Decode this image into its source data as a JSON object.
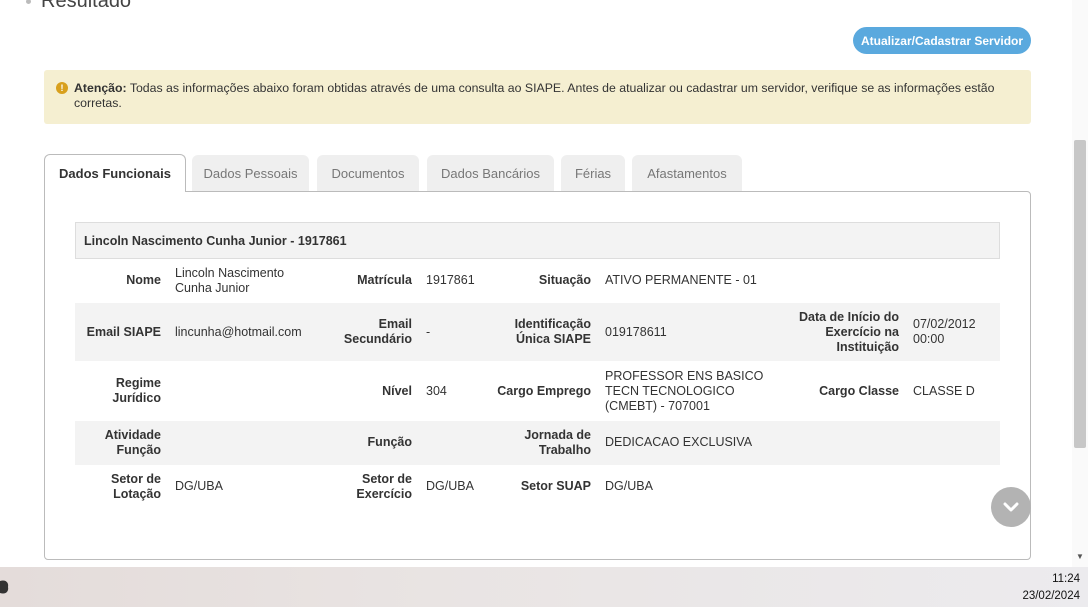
{
  "section": {
    "title": "Resultado"
  },
  "actions": {
    "update_button": "Atualizar/Cadastrar Servidor"
  },
  "alert": {
    "prefix": "Atenção:",
    "text": " Todas as informações abaixo foram obtidas através de uma consulta ao SIAPE. Antes de atualizar ou cadastrar um servidor, verifique se as informações estão corretas."
  },
  "tabs": [
    {
      "label": "Dados Funcionais",
      "active": true
    },
    {
      "label": "Dados Pessoais"
    },
    {
      "label": "Documentos"
    },
    {
      "label": "Dados Bancários"
    },
    {
      "label": "Férias"
    },
    {
      "label": "Afastamentos"
    }
  ],
  "record": {
    "header": "Lincoln Nascimento Cunha Junior - 1917861",
    "rows": [
      [
        {
          "label": "Nome",
          "value": "Lincoln Nascimento Cunha Junior"
        },
        {
          "label": "Matrícula",
          "value": "1917861"
        },
        {
          "label": "Situação",
          "value": "ATIVO PERMANENTE - 01"
        }
      ],
      [
        {
          "label": "Email SIAPE",
          "value": "lincunha@hotmail.com"
        },
        {
          "label": "Email Secundário",
          "value": "-"
        },
        {
          "label": "Identificação Única SIAPE",
          "value": "019178611"
        },
        {
          "label": "Data de Início do Exercício na Instituição",
          "value": "07/02/2012 00:00"
        }
      ],
      [
        {
          "label": "Regime Jurídico",
          "value": ""
        },
        {
          "label": "Nível",
          "value": "304"
        },
        {
          "label": "Cargo Emprego",
          "value": "PROFESSOR ENS BASICO TECN TECNOLOGICO (CMEBT) - 707001"
        },
        {
          "label": "Cargo Classe",
          "value": "CLASSE D"
        }
      ],
      [
        {
          "label": "Atividade Função",
          "value": ""
        },
        {
          "label": "Função",
          "value": ""
        },
        {
          "label": "Jornada de Trabalho",
          "value": "DEDICACAO EXCLUSIVA"
        }
      ],
      [
        {
          "label": "Setor de Lotação",
          "value": "DG/UBA"
        },
        {
          "label": "Setor de Exercício",
          "value": "DG/UBA"
        },
        {
          "label": "Setor SUAP",
          "value": "DG/UBA"
        }
      ]
    ]
  },
  "taskbar": {
    "time": "11:24",
    "date": "23/02/2024"
  },
  "colors": {
    "accent": "#5aa9de",
    "alert_bg": "#f5efd1",
    "alert_icon": "#d8a01d"
  }
}
